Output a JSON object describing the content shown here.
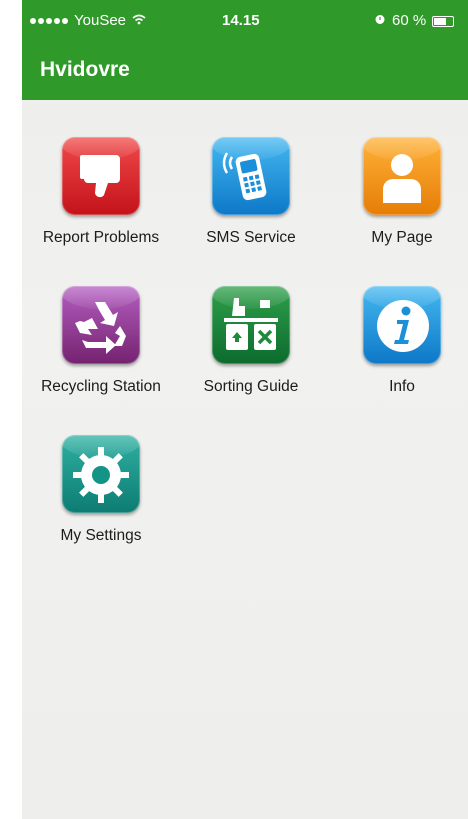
{
  "status_bar": {
    "carrier": "YouSee",
    "time": "14.15",
    "battery": "60 %"
  },
  "nav": {
    "title": "Hvidovre"
  },
  "menu": [
    {
      "label": "Report Problems",
      "icon": "thumbs-down-icon",
      "color": "#d61f26"
    },
    {
      "label": "SMS Service",
      "icon": "mobile-phone-icon",
      "color": "#1b8fd9"
    },
    {
      "label": "My Page",
      "icon": "person-icon",
      "color": "#f29a17"
    },
    {
      "label": "Recycling Station",
      "icon": "recycle-icon",
      "color": "#8e3596"
    },
    {
      "label": "Sorting Guide",
      "icon": "sorting-bins-icon",
      "color": "#1f8a3b"
    },
    {
      "label": "Info",
      "icon": "info-icon",
      "color": "#1b8fd9"
    },
    {
      "label": "My Settings",
      "icon": "gear-icon",
      "color": "#149487"
    }
  ],
  "colors": {
    "bar": "#2f9a29",
    "background": "#efefed"
  }
}
